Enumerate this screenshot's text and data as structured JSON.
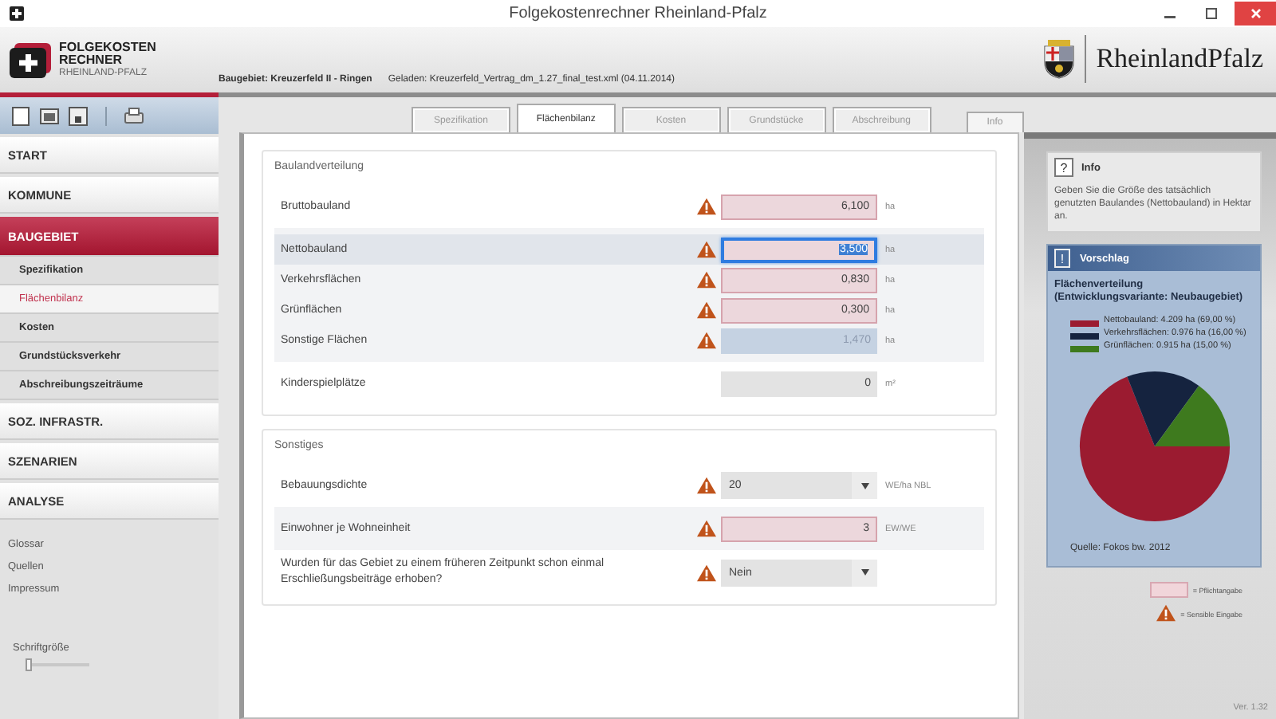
{
  "window": {
    "title": "Folgekostenrechner Rheinland-Pfalz"
  },
  "logo": {
    "line1": "FOLGEKOSTEN",
    "line2": "RECHNER",
    "line3": "RHEINLAND-PFALZ"
  },
  "project": {
    "area": "Baugebiet: Kreuzerfeld II - Ringen",
    "loaded": "Geladen: Kreuzerfeld_Vertrag_dm_1.27_final_test.xml  (04.11.2014)"
  },
  "brand": "RheinlandPfalz",
  "tabs": [
    {
      "label": "Spezifikation",
      "selected": false
    },
    {
      "label": "Flächenbilanz",
      "selected": true
    },
    {
      "label": "Kosten",
      "selected": false
    },
    {
      "label": "Grundstücke",
      "selected": false
    },
    {
      "label": "Abschreibung",
      "selected": false
    }
  ],
  "info_tab": {
    "label": "Info"
  },
  "sidebar": {
    "items": [
      {
        "label": "START",
        "selected": false
      },
      {
        "label": "KOMMUNE",
        "selected": false
      },
      {
        "label": "BAUGEBIET",
        "selected": true,
        "children": [
          {
            "label": "Spezifikation",
            "selected": false
          },
          {
            "label": "Flächenbilanz",
            "selected": true
          },
          {
            "label": "Kosten",
            "selected": false
          },
          {
            "label": "Grundstücksverkehr",
            "selected": false
          },
          {
            "label": "Abschreibungszeiträume",
            "selected": false
          }
        ]
      },
      {
        "label": "SOZ. INFRASTR.",
        "selected": false
      },
      {
        "label": "SZENARIEN",
        "selected": false
      },
      {
        "label": "ANALYSE",
        "selected": false
      }
    ],
    "links": [
      "Glossar",
      "Quellen",
      "Impressum"
    ],
    "font_size": {
      "label": "Schriftgröße",
      "level": 0
    }
  },
  "sections": [
    {
      "title": "Baulandverteilung",
      "groups": [
        {
          "shaded": false,
          "rows": [
            {
              "label": "Bruttobauland",
              "kind": "required",
              "warning": true,
              "value": "6,100",
              "unit": "ha",
              "selected": false,
              "focused": false
            }
          ]
        },
        {
          "shaded": true,
          "rows": [
            {
              "label": "Nettobauland",
              "kind": "required",
              "warning": true,
              "value": "3,500",
              "unit": "ha",
              "selected": true,
              "focused": true
            },
            {
              "label": "Verkehrsflächen",
              "kind": "required",
              "warning": true,
              "value": "0,830",
              "unit": "ha",
              "selected": false,
              "focused": false
            },
            {
              "label": "Grünflächen",
              "kind": "required",
              "warning": true,
              "value": "0,300",
              "unit": "ha",
              "selected": false,
              "focused": false
            },
            {
              "label": "Sonstige Flächen",
              "kind": "computed",
              "warning": true,
              "value": "1,470",
              "unit": "ha",
              "selected": false,
              "focused": false
            }
          ]
        },
        {
          "shaded": false,
          "rows": [
            {
              "label": "Kinderspielplätze",
              "kind": "plain",
              "warning": false,
              "value": "0",
              "unit": "m²",
              "selected": false,
              "focused": false
            }
          ]
        }
      ]
    },
    {
      "title": "Sonstiges",
      "groups": [
        {
          "shaded": false,
          "rows": [
            {
              "label": "Bebauungsdichte",
              "kind": "select",
              "warning": true,
              "value": "20",
              "unit": "WE/ha NBL",
              "selected": false
            }
          ]
        },
        {
          "shaded": true,
          "rows": [
            {
              "label": "Einwohner je Wohneinheit",
              "kind": "required",
              "warning": true,
              "value": "3",
              "unit": "EW/WE",
              "selected": false,
              "focused": false
            }
          ]
        },
        {
          "shaded": false,
          "rows": [
            {
              "label": "Wurden für das Gebiet zu einem früheren Zeitpunkt schon einmal Erschließungsbeiträge erhoben?",
              "kind": "select",
              "warning": true,
              "value": "Nein",
              "selected": false
            }
          ]
        }
      ]
    }
  ],
  "info": {
    "icon": "?",
    "title": "Info",
    "text": "Geben Sie die Größe des tatsächlich genutzten Baulandes (Nettobauland) in Hektar an."
  },
  "suggestion": {
    "icon": "!",
    "title": "Vorschlag",
    "heading": "Flächenverteilung (Entwicklungsvariante: Neubaugebiet)",
    "chart_data": {
      "type": "pie",
      "categories": [
        "Nettobauland: 4.209 ha (69,00 %)",
        "Verkehrsflächen: 0.976 ha (16,00 %)",
        "Grünflächen: 0.915 ha (15,00 %)"
      ],
      "series": [
        {
          "values": [
            69,
            16,
            15
          ]
        }
      ],
      "colors": [
        "#9b1b30",
        "#15233f",
        "#3e7a1e"
      ]
    },
    "source": "Quelle: Fokos bw. 2012"
  },
  "legend": [
    {
      "kind": "required",
      "label": "= Pflichtangabe"
    },
    {
      "kind": "warning",
      "label": "= Sensible Eingabe"
    }
  ],
  "version": "Ver. 1.32"
}
